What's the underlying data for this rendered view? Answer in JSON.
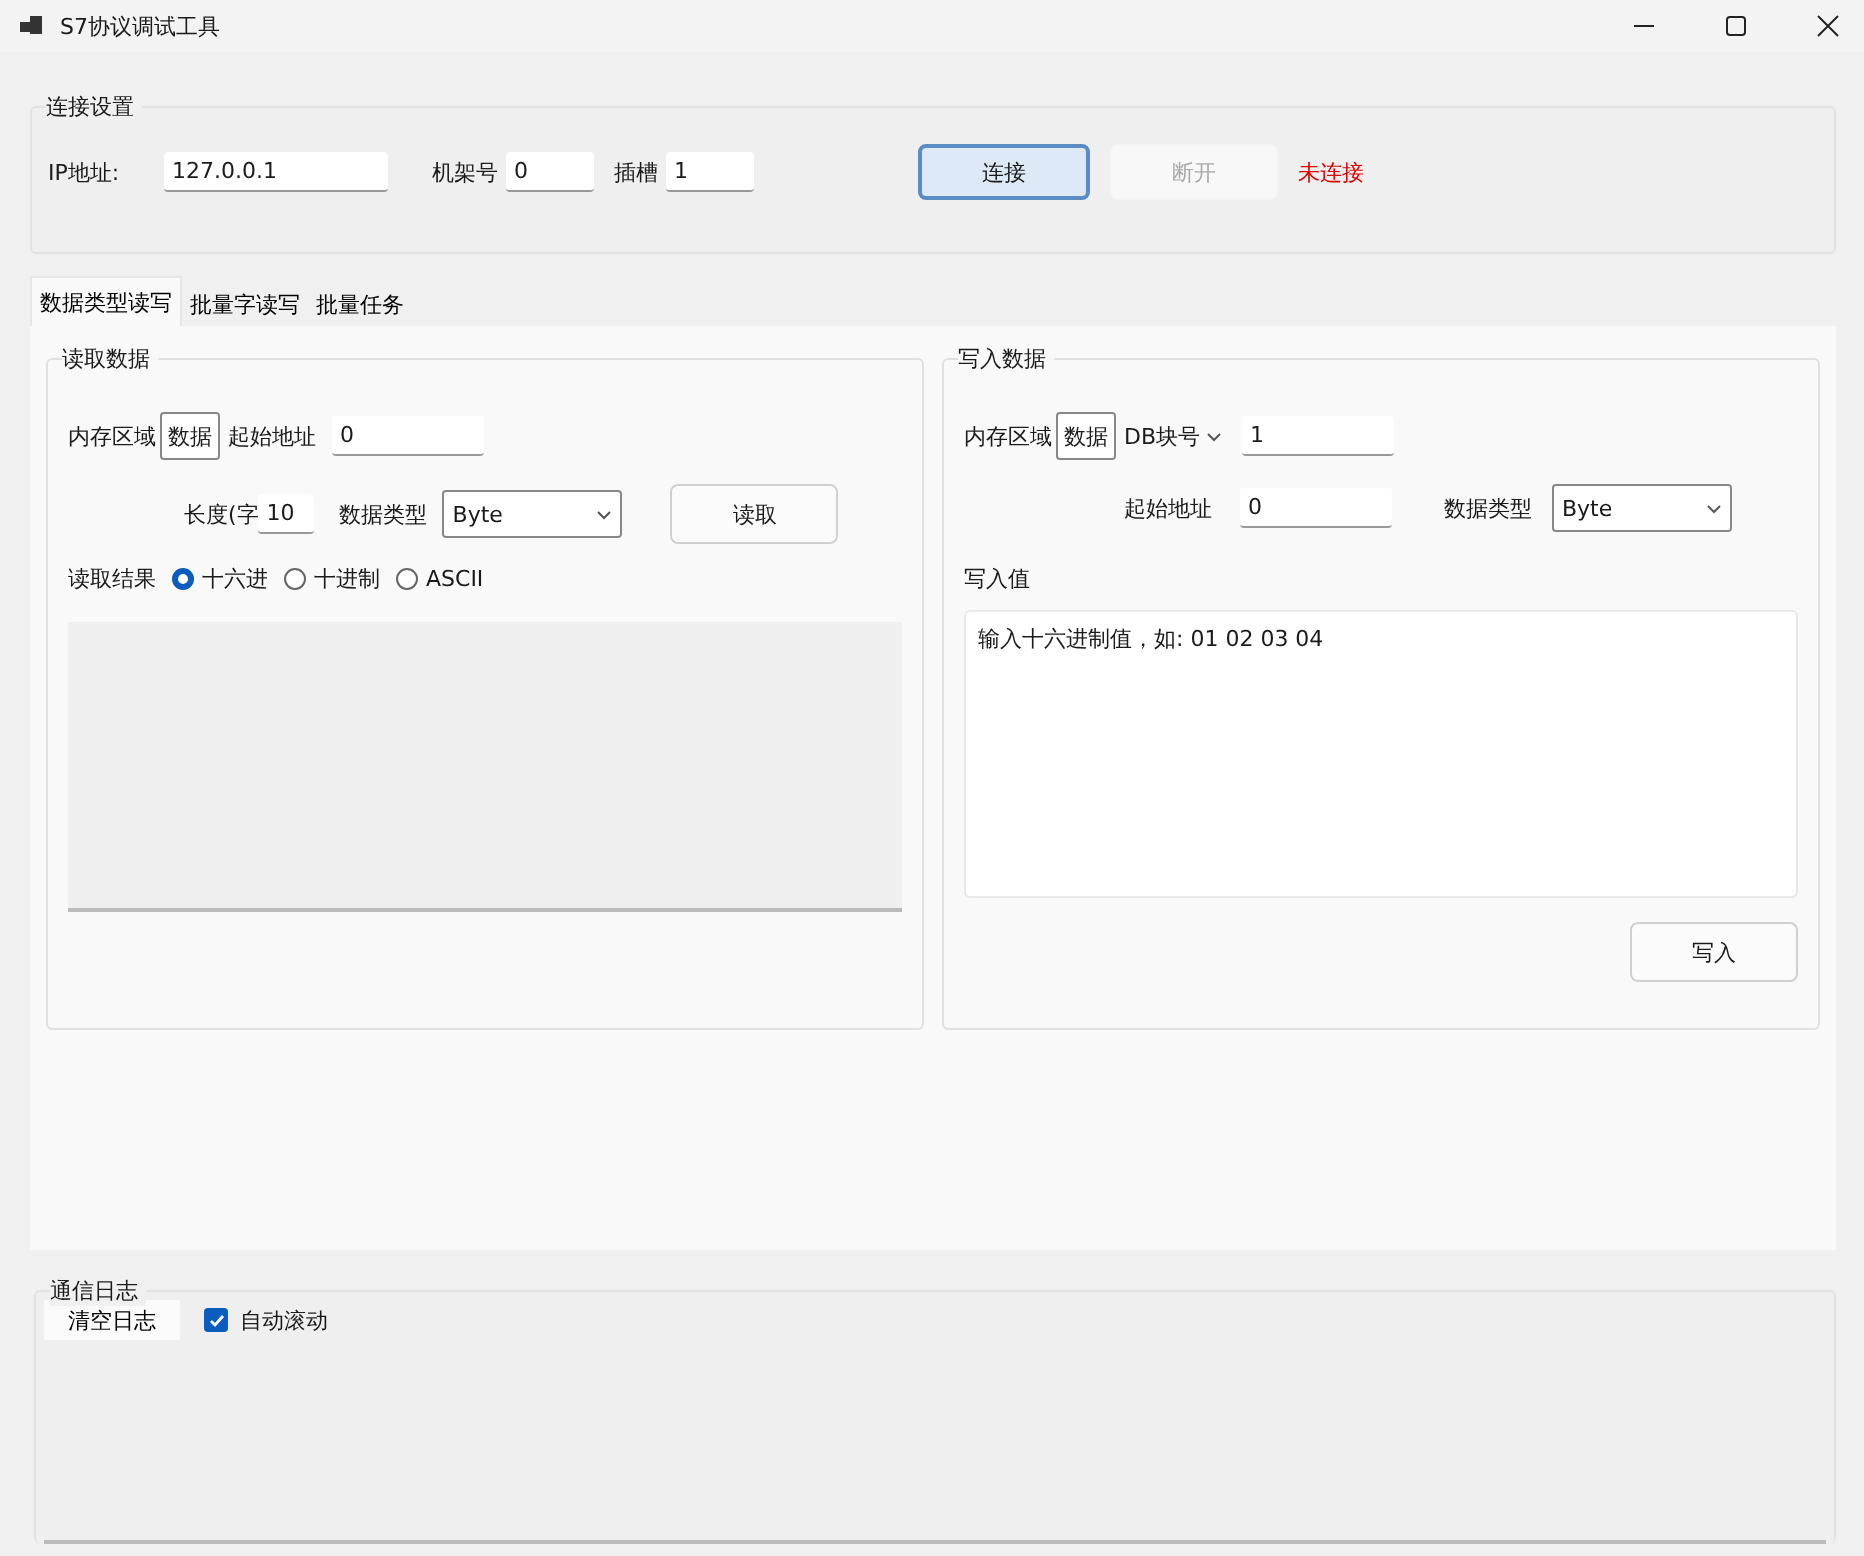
{
  "window": {
    "title": "S7协议调试工具"
  },
  "connection": {
    "title": "连接设置",
    "ip_label": "IP地址:",
    "ip": "127.0.0.1",
    "rack_label": "机架号",
    "rack": "0",
    "slot_label": "插槽",
    "slot": "1",
    "connect": {
      "label": "连接",
      "disabled": false
    },
    "disconnect": {
      "label": "断开",
      "disabled": true
    },
    "status": "未连接"
  },
  "tabs": [
    {
      "label": "数据类型读写",
      "selected": true
    },
    {
      "label": "批量字读写",
      "selected": false
    },
    {
      "label": "批量任务",
      "selected": false
    }
  ],
  "read": {
    "title": "读取数据",
    "area_label": "内存区域",
    "area": "数据",
    "start_label": "起始地址",
    "start": "0",
    "length_label": "长度(字",
    "length": "10",
    "type_label": "数据类型",
    "type": "Byte",
    "button": "读取",
    "result_label": "读取结果",
    "formats": [
      {
        "label": "十六进",
        "selected": true
      },
      {
        "label": "十进制",
        "selected": false
      },
      {
        "label": "ASCII",
        "selected": false
      }
    ]
  },
  "write": {
    "title": "写入数据",
    "area_label": "内存区域",
    "area": "数据",
    "db_label": "DB块号",
    "db": "1",
    "start_label": "起始地址",
    "start": "0",
    "type_label": "数据类型",
    "type": "Byte",
    "value_label": "写入值",
    "placeholder": "输入十六进制值，如: 01 02 03 04",
    "button": "写入"
  },
  "log": {
    "title": "通信日志",
    "clear": "清空日志",
    "auto_scroll": {
      "label": "自动滚动",
      "checked": true
    }
  }
}
